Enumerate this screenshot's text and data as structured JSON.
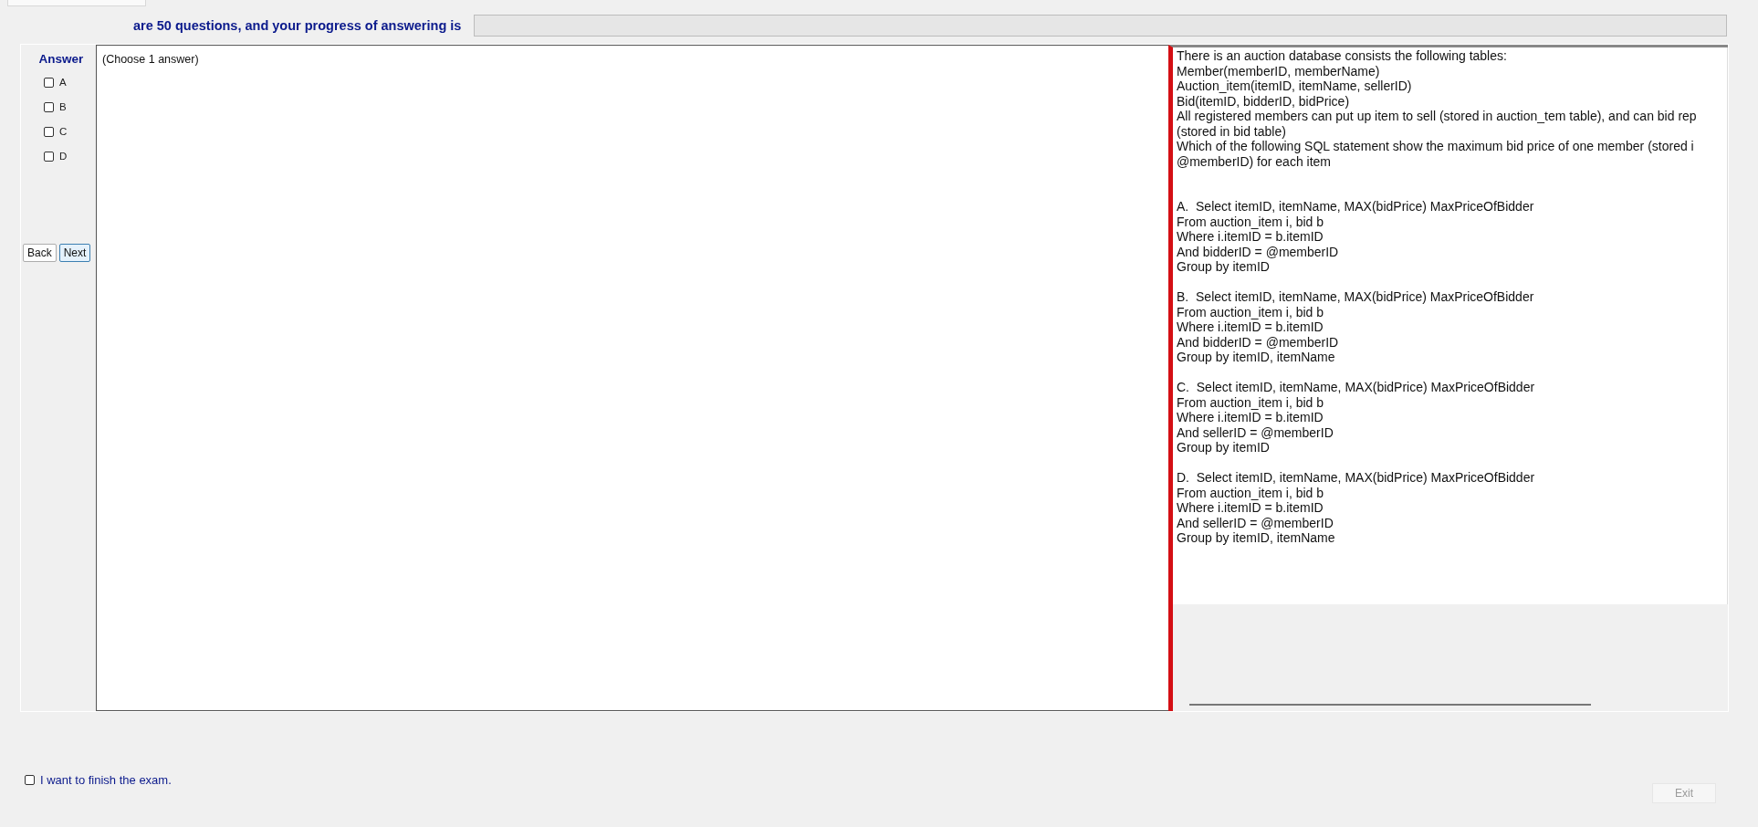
{
  "header": {
    "progress_label": "are 50 questions, and your progress of answering is",
    "progress": {
      "level": 0
    }
  },
  "answer_panel": {
    "title": "Answer",
    "options": [
      {
        "label": "A",
        "checked": false
      },
      {
        "label": "B",
        "checked": false
      },
      {
        "label": "C",
        "checked": false
      },
      {
        "label": "D",
        "checked": false
      }
    ],
    "buttons": [
      {
        "label": "Back",
        "focused": false
      },
      {
        "label": "Next",
        "focused": true
      }
    ]
  },
  "question_pane": {
    "instruction": "(Choose 1 answer)"
  },
  "question_text": {
    "intro": [
      "There is an auction database consists the following tables:",
      "Member(memberID, memberName)",
      "Auction_item(itemID, itemName, sellerID)",
      "Bid(itemID, bidderID, bidPrice)",
      "All registered members can put up item to sell (stored in auction_tem table), and can bid rep",
      "(stored in bid table)",
      "Which of the following SQL statement show the maximum bid price of one member (stored i",
      "@memberID) for each item"
    ],
    "choices": [
      [
        "A.  Select itemID, itemName, MAX(bidPrice) MaxPriceOfBidder",
        "From auction_item i, bid b",
        "Where i.itemID = b.itemID",
        "And bidderID = @memberID",
        "Group by itemID"
      ],
      [
        "B.  Select itemID, itemName, MAX(bidPrice) MaxPriceOfBidder",
        "From auction_item i, bid b",
        "Where i.itemID = b.itemID",
        "And bidderID = @memberID",
        "Group by itemID, itemName"
      ],
      [
        "C.  Select itemID, itemName, MAX(bidPrice) MaxPriceOfBidder",
        "From auction_item i, bid b",
        "Where i.itemID = b.itemID",
        "And sellerID = @memberID",
        "Group by itemID"
      ],
      [
        "D.  Select itemID, itemName, MAX(bidPrice) MaxPriceOfBidder",
        "From auction_item i, bid b",
        "Where i.itemID = b.itemID",
        "And sellerID = @memberID",
        "Group by itemID, itemName"
      ]
    ]
  },
  "footer": {
    "finish": {
      "label": "I want to finish the exam.",
      "checked": false
    },
    "exit_button": {
      "label": "Exit",
      "disabled": true
    }
  }
}
